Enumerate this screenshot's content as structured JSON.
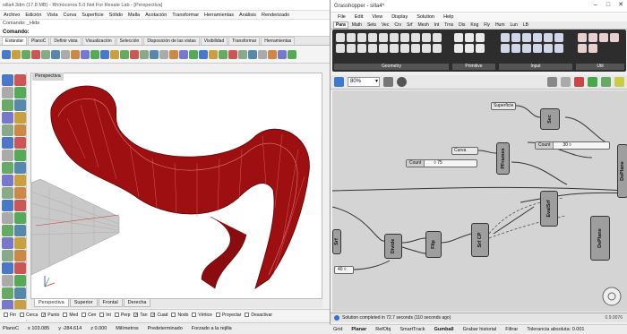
{
  "rhino": {
    "title": "silla4.3dm (17.8 MB) - Rhinoceros 5.0 Not For Resale Lab - [Perspectiva]",
    "menu": [
      "Archivo",
      "Edición",
      "Vista",
      "Curva",
      "Superficie",
      "Sólido",
      "Malla",
      "Acotación",
      "Transformar",
      "Herramientas",
      "Análisis",
      "Renderizado"
    ],
    "cmd_history": "Comando: _Hide",
    "cmd_prompt": "Comando:",
    "toolbar_tabs": [
      "Estándar",
      "PlanoC",
      "Definir vista",
      "Visualización",
      "Selección",
      "Disposición de las vistas",
      "Visibilidad",
      "Transformar",
      "Herramientas"
    ],
    "viewport_label": "Perspectiva",
    "viewport_tabs": [
      "Perspectiva",
      "Superior",
      "Frontal",
      "Derecha"
    ],
    "osnaps": [
      {
        "label": "Fin",
        "on": false
      },
      {
        "label": "Cerca",
        "on": false
      },
      {
        "label": "Punto",
        "on": true
      },
      {
        "label": "Med",
        "on": false
      },
      {
        "label": "Cen",
        "on": false
      },
      {
        "label": "Int",
        "on": false
      },
      {
        "label": "Perp",
        "on": false
      },
      {
        "label": "Tan",
        "on": true
      },
      {
        "label": "Cuad",
        "on": true
      },
      {
        "label": "Nodo",
        "on": false
      },
      {
        "label": "Vértice",
        "on": false
      },
      {
        "label": "Proyectar",
        "on": false
      },
      {
        "label": "Desactivar",
        "on": false
      }
    ],
    "status": [
      "PlanoC",
      "x 103.085",
      "y -284.614",
      "z 0.000",
      "Milímetros",
      "Predeterminado",
      "Forzado a la rejilla"
    ]
  },
  "gh": {
    "title": "Grasshopper - silla4*",
    "menu": [
      "File",
      "Edit",
      "View",
      "Display",
      "Solution",
      "Help"
    ],
    "tabs": [
      "Para",
      "Math",
      "Sets",
      "Vec",
      "Crv",
      "Srf",
      "Mesh",
      "Int",
      "Trns",
      "Dis",
      "Kng",
      "Fly",
      "Hum",
      "Lun",
      "LB"
    ],
    "ribbon_groups": [
      "Geometry",
      "Primitive",
      "Input",
      "Util"
    ],
    "zoom": "80%",
    "nodes": [
      {
        "name": "Srf"
      },
      {
        "name": "PFrames"
      },
      {
        "name": "Divide"
      },
      {
        "name": "Flip"
      },
      {
        "name": "Srf CP"
      },
      {
        "name": "EvalSrf"
      },
      {
        "name": "DePlane"
      },
      {
        "name": "DePlane"
      },
      {
        "name": "Sec"
      }
    ],
    "panels": [
      "Superficie",
      "Curva"
    ],
    "sliders": [
      {
        "name": "Count",
        "value": "◊ 75"
      },
      {
        "name": "Count",
        "value": "30 ◊"
      },
      {
        "name": "",
        "value": "40 ◊"
      }
    ],
    "solution_status": "Solution completed in 72.7 seconds (110 seconds ago)",
    "version": "0.9.0076",
    "bottom_status": [
      "Grid",
      "Planar",
      "RefObj",
      "SmartTrack",
      "Gumball",
      "Grabar historial",
      "Filtrar",
      "Tolerancia absoluta: 0.001"
    ]
  },
  "colors": {
    "model_red": "#9e0f12",
    "node_gray": "#9e9e9e",
    "canvas": "#d4d4d4",
    "ribbon": "#2d2d2d"
  }
}
